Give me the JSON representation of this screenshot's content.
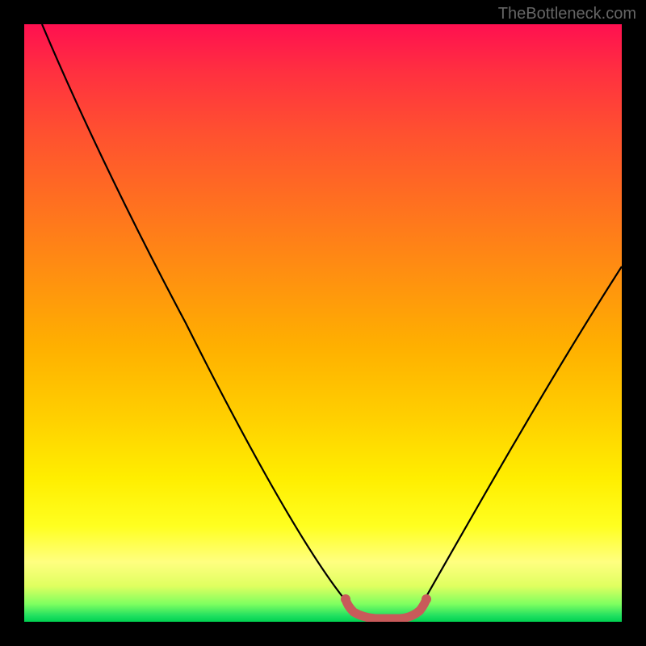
{
  "watermark": "TheBottleneck.com",
  "chart_data": {
    "type": "line",
    "title": "",
    "xlabel": "",
    "ylabel": "",
    "xlim": [
      0,
      100
    ],
    "ylim": [
      0,
      100
    ],
    "series": [
      {
        "name": "bottleneck-curve",
        "x": [
          3,
          10,
          20,
          30,
          40,
          50,
          53,
          56,
          60,
          64,
          66,
          70,
          80,
          90,
          100
        ],
        "y": [
          100,
          85,
          67,
          49,
          32,
          14,
          6,
          2,
          0,
          0,
          2,
          8,
          22,
          38,
          55
        ]
      }
    ],
    "optimal_region": {
      "x_start": 54,
      "x_end": 66,
      "color": "#cc6666"
    },
    "gradient_stops": [
      {
        "pos": 0,
        "color": "#ff1050"
      },
      {
        "pos": 50,
        "color": "#ffb000"
      },
      {
        "pos": 85,
        "color": "#ffff30"
      },
      {
        "pos": 100,
        "color": "#00d050"
      }
    ]
  }
}
